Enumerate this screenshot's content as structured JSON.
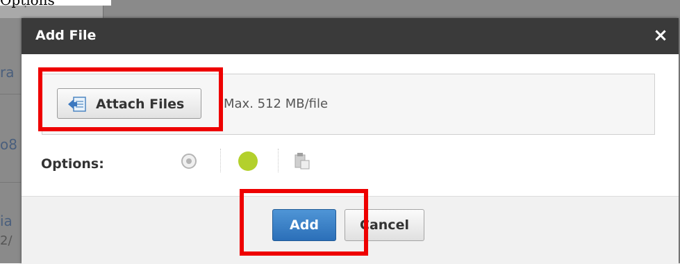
{
  "background": {
    "tab_label": "Options",
    "fragments": [
      "ra",
      "o8",
      "ia",
      "2/"
    ]
  },
  "page_heading": "Options",
  "dialog": {
    "title": "Add File",
    "close_glyph": "×",
    "attach_button_label": "Attach Files",
    "max_size_text": "Max. 512 MB/file",
    "options_label": "Options:",
    "option_icons": [
      "radio-target-icon",
      "green-dot-icon",
      "clipboard-icon"
    ],
    "add_button_label": "Add",
    "cancel_button_label": "Cancel"
  },
  "colors": {
    "header_bg": "#3a3a3a",
    "primary_button": "#2b6fb8",
    "green_dot": "#b3d02c",
    "highlight": "#ee0000"
  }
}
